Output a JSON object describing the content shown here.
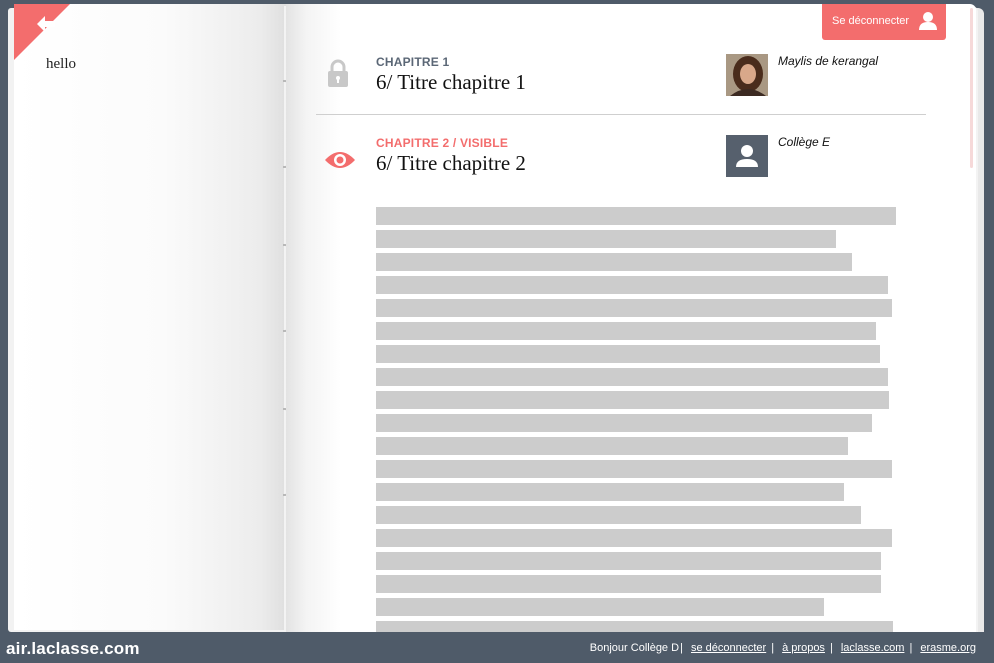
{
  "left_page": {
    "text": "hello"
  },
  "header": {
    "logout_label": "Se déconnecter"
  },
  "colors": {
    "accent": "#f36d6d",
    "frame": "#4f5b69",
    "muted": "#5b6776",
    "placeholder": "#cccccc"
  },
  "chapters": [
    {
      "kicker": "CHAPITRE 1",
      "title": "6/ Titre chapitre 1",
      "author": "Maylis de kerangal",
      "icon": "lock-icon"
    },
    {
      "kicker": "CHAPITRE 2 / VISIBLE",
      "title": "6/ Titre chapitre 2",
      "author": "Collège E",
      "icon": "eye-icon"
    }
  ],
  "footer": {
    "brand": "air.laclasse.com",
    "greeting": "Bonjour Collège D",
    "links": [
      "se déconnecter",
      "à propos",
      "laclasse.com",
      "erasme.org"
    ]
  }
}
